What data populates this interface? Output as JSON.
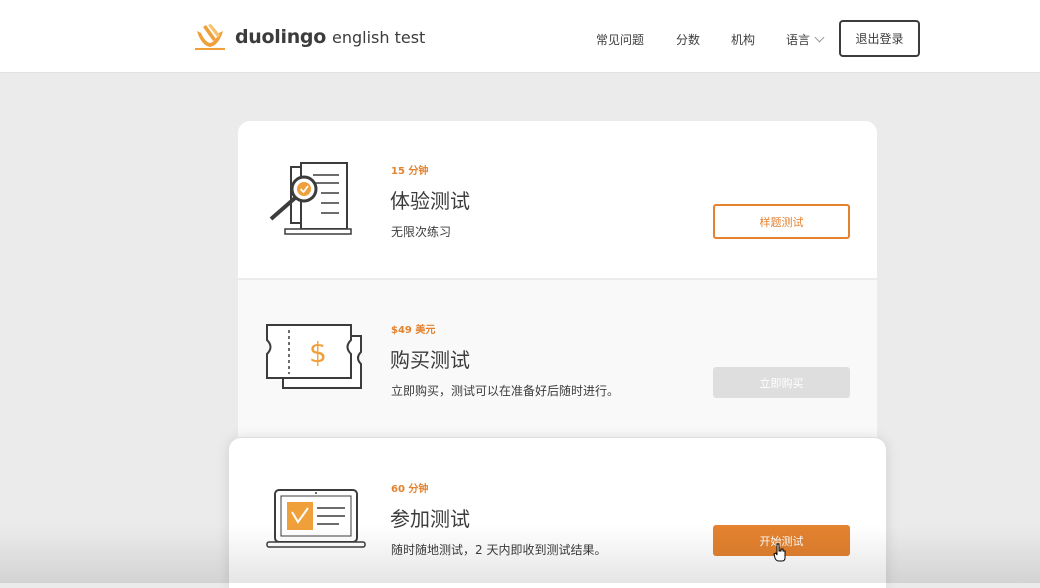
{
  "header": {
    "brand_name": "duolingo",
    "brand_sub": "english test",
    "nav": [
      "常见问题",
      "分数",
      "机构",
      "语言"
    ],
    "logout_label": "退出登录"
  },
  "cards": [
    {
      "meta": "15 分钟",
      "title": "体验测试",
      "desc": "无限次练习",
      "button": "样题测试"
    },
    {
      "meta": "$49 美元",
      "title": "购买测试",
      "desc": "立即购买，测试可以在准备好后随时进行。",
      "button": "立即购买"
    },
    {
      "meta": "60 分钟",
      "title": "参加测试",
      "desc": "随时随地测试，2 天内即收到测试结果。",
      "button": "开始测试"
    }
  ],
  "colors": {
    "accent": "#e4822f",
    "text": "#3c3c3c",
    "disabled": "#dedede",
    "background": "#ebebeb"
  },
  "icons": [
    "duolingo-logo-icon",
    "magnifier-document-icon",
    "ticket-dollar-icon",
    "laptop-certificate-icon",
    "chevron-down-icon",
    "hand-cursor-icon"
  ]
}
